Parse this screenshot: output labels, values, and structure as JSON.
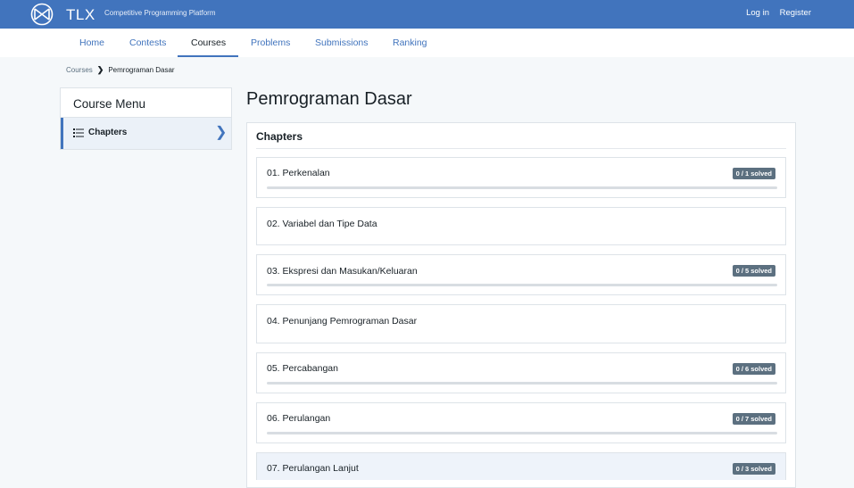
{
  "header": {
    "brand": "TLX",
    "tagline": "Competitive Programming Platform",
    "login": "Log in",
    "register": "Register",
    "accent_color": "#4174bd"
  },
  "nav": {
    "items": [
      "Home",
      "Contests",
      "Courses",
      "Problems",
      "Submissions",
      "Ranking"
    ],
    "active": "Courses"
  },
  "breadcrumb": {
    "root": "Courses",
    "separator": "❯",
    "current": "Pemrograman Dasar"
  },
  "sidebar": {
    "title": "Course Menu",
    "items": [
      {
        "label": "Chapters",
        "icon": "list-icon",
        "chevron": "❯"
      }
    ]
  },
  "main": {
    "title": "Pemrograman Dasar",
    "section_heading": "Chapters",
    "chapters": [
      {
        "title": "01. Perkenalan",
        "badge": "0 / 1 solved",
        "progress": 0
      },
      {
        "title": "02. Variabel dan Tipe Data"
      },
      {
        "title": "03. Ekspresi dan Masukan/Keluaran",
        "badge": "0 / 5 solved",
        "progress": 0
      },
      {
        "title": "04. Penunjang Pemrograman Dasar"
      },
      {
        "title": "05. Percabangan",
        "badge": "0 / 6 solved",
        "progress": 0
      },
      {
        "title": "06. Perulangan",
        "badge": "0 / 7 solved",
        "progress": 0
      },
      {
        "title": "07. Perulangan Lanjut",
        "badge": "0 / 3 solved",
        "progress": 0
      }
    ]
  }
}
